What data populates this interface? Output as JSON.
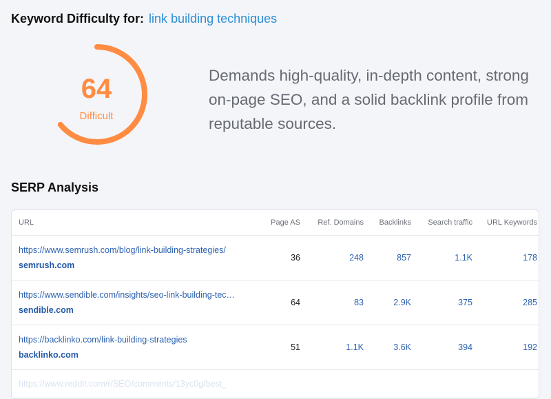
{
  "header": {
    "prefix": "Keyword Difficulty for:",
    "keyword": "link building techniques"
  },
  "difficulty": {
    "score": "64",
    "level": "Difficult",
    "percent": 64,
    "color": "#ff8c42",
    "description": "Demands high-quality, in-depth content, strong on-page SEO, and a solid backlink profile from reputable sources."
  },
  "serp": {
    "title": "SERP Analysis",
    "columns": [
      "URL",
      "Page AS",
      "Ref. Domains",
      "Backlinks",
      "Search traffic",
      "URL Keywords"
    ],
    "rows": [
      {
        "url": "https://www.semrush.com/blog/link-building-strategies/",
        "domain": "semrush.com",
        "page_as": "36",
        "ref_domains": "248",
        "backlinks": "857",
        "search_traffic": "1.1K",
        "url_keywords": "178"
      },
      {
        "url": "https://www.sendible.com/insights/seo-link-building-tec…",
        "domain": "sendible.com",
        "page_as": "64",
        "ref_domains": "83",
        "backlinks": "2.9K",
        "search_traffic": "375",
        "url_keywords": "285"
      },
      {
        "url": "https://backlinko.com/link-building-strategies",
        "domain": "backlinko.com",
        "page_as": "51",
        "ref_domains": "1.1K",
        "backlinks": "3.6K",
        "search_traffic": "394",
        "url_keywords": "192"
      },
      {
        "url": "https://www.reddit.com/r/SEO/comments/13yc0g/best_"
      }
    ]
  }
}
